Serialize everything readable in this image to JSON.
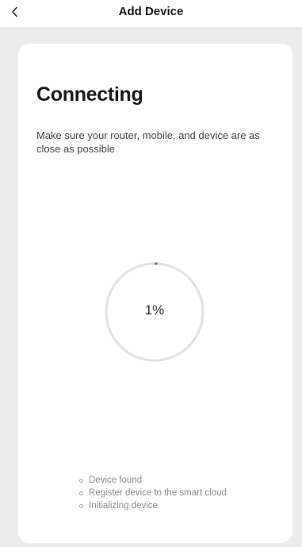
{
  "header": {
    "back_icon": "chevron-left-icon",
    "title": "Add Device"
  },
  "card": {
    "title": "Connecting",
    "description": "Make sure your router, mobile, and device are as close as possible"
  },
  "progress": {
    "percent": 1,
    "label": "1%",
    "colors": {
      "track": "#e0e0e0",
      "indicator": "#4a86c5"
    }
  },
  "steps": [
    {
      "label": "Device found"
    },
    {
      "label": "Register device to the smart cloud"
    },
    {
      "label": "Initializing device"
    }
  ]
}
